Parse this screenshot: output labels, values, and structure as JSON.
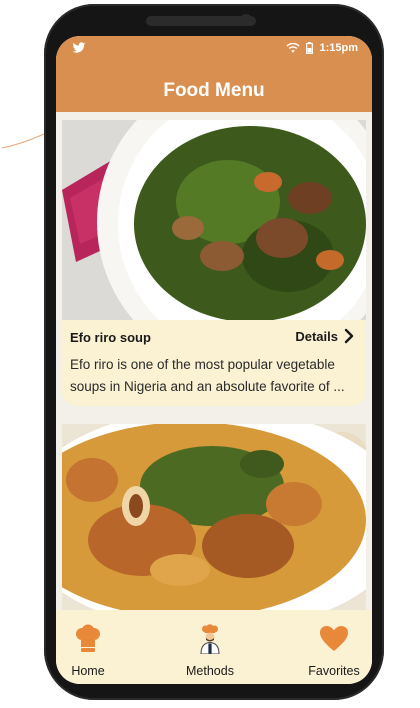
{
  "status_bar": {
    "time": "1:15pm"
  },
  "header": {
    "title": "Food Menu"
  },
  "cards": [
    {
      "title": "Efo riro soup",
      "details_label": "Details",
      "description": "Efo riro is one of the most popular vegetable soups in Nigeria and an absolute favorite of ..."
    },
    {
      "title": "",
      "details_label": "",
      "description": ""
    }
  ],
  "bottom_nav": {
    "items": [
      {
        "label": "Home",
        "icon": "chef-hat-icon"
      },
      {
        "label": "Methods",
        "icon": "chef-icon"
      },
      {
        "label": "Favorites",
        "icon": "heart-icon"
      }
    ]
  },
  "colors": {
    "header": "#d98f4f",
    "card_info": "#fbf1d3",
    "nav_bg": "#fbf1d3",
    "accent": "#e8893a"
  }
}
